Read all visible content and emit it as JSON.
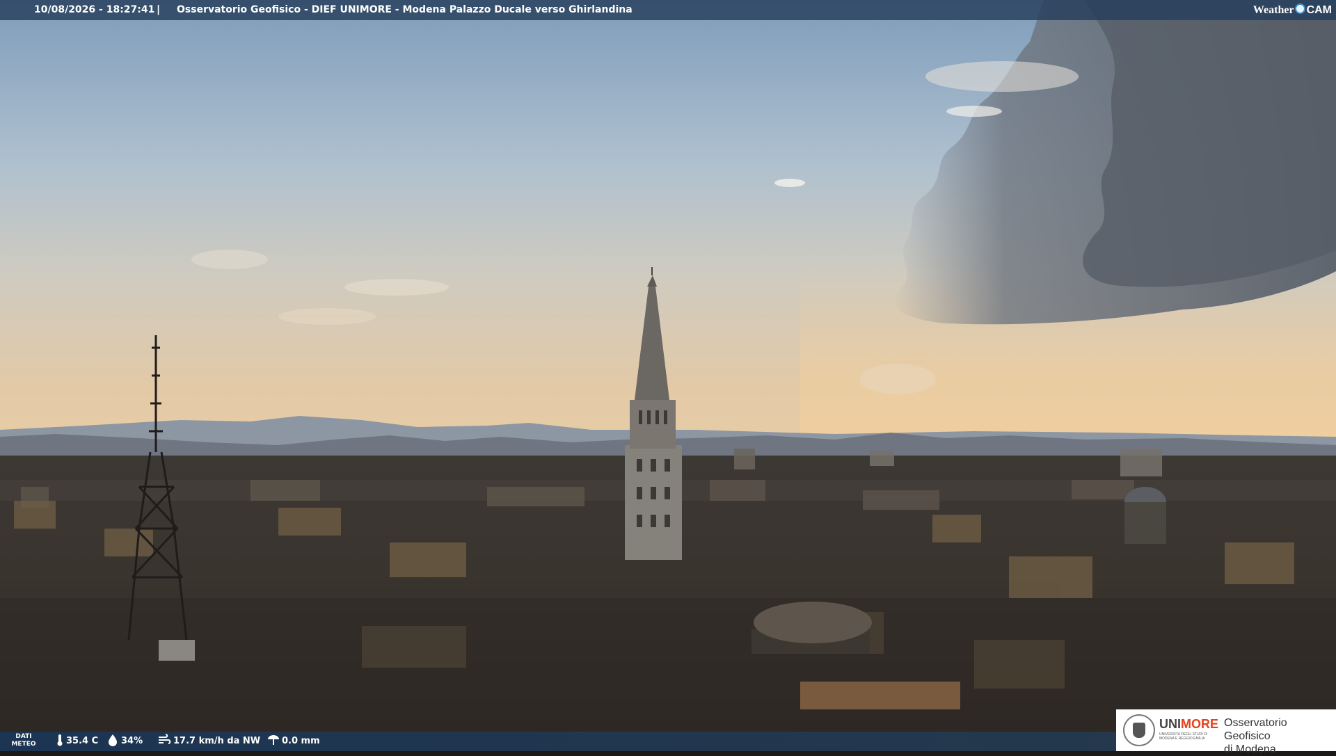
{
  "header": {
    "timestamp": "10/08/2026 - 18:27:41",
    "separator": "|",
    "title": "Osservatorio Geofisico - DIEF UNIMORE - Modena Palazzo Ducale verso Ghirlandina"
  },
  "brand": {
    "weather": "Weather",
    "cam": "CAM"
  },
  "footer": {
    "label_line1": "DATI",
    "label_line2": "METEO",
    "temperature": "35.4 C",
    "humidity": "34%",
    "wind": "17.7 km/h da NW",
    "rain": "0.0 mm"
  },
  "institution": {
    "name_part1": "UNI",
    "name_part2": "MORE",
    "subtitle": "UNIVERSITÀ DEGLI STUDI DI MODENA E REGGIO EMILIA",
    "observatory_line1": "Osservatorio Geofisico",
    "observatory_line2": "di Modena"
  },
  "colors": {
    "accent_more": "#e2421d",
    "bar": "#263e5c"
  },
  "icons": [
    "thermometer-icon",
    "humidity-icon",
    "wind-icon",
    "rain-gauge-icon"
  ]
}
